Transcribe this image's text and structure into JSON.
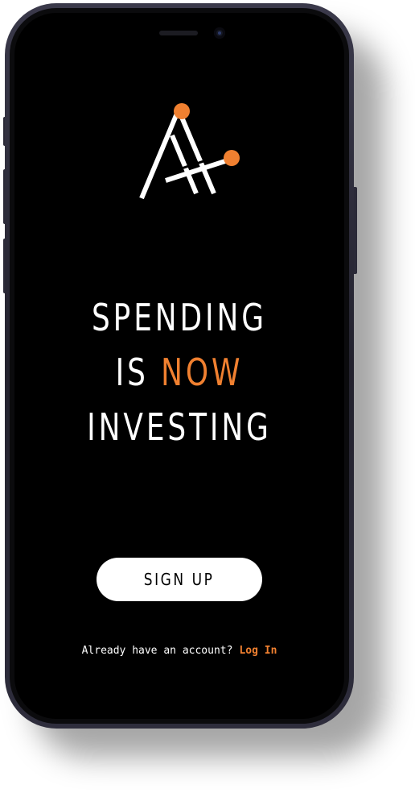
{
  "headline": {
    "line1": "SPENDING",
    "line2_prefix": "IS ",
    "line2_accent": "NOW",
    "line3": "INVESTING"
  },
  "signup_label": "SIGN UP",
  "login_prompt": "Already have an account?",
  "login_link": "Log In",
  "colors": {
    "accent": "#f08030",
    "background": "#000000",
    "text": "#ffffff",
    "button_bg": "#ffffff"
  },
  "icons": {
    "logo": "app-logo-icon"
  }
}
